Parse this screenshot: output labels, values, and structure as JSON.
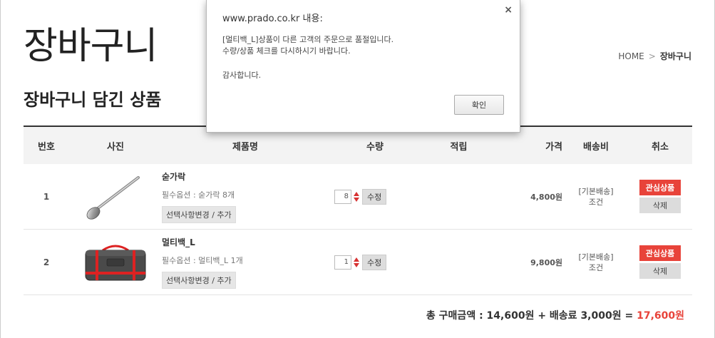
{
  "page": {
    "title": "장바구니",
    "section_title": "장바구니 담긴 상품"
  },
  "breadcrumb": {
    "home": "HOME",
    "separator": ">",
    "current": "장바구니"
  },
  "table": {
    "headers": {
      "no": "번호",
      "photo": "사진",
      "name": "제품명",
      "qty": "수량",
      "point": "적립",
      "price": "가격",
      "ship": "배송비",
      "cancel": "취소"
    },
    "rows": [
      {
        "no": "1",
        "name": "숟가락",
        "option": "필수옵션 : 숟가락 8개",
        "option_button": "선택사항변경 / 추가",
        "qty": "8",
        "qty_button": "수정",
        "price": "4,800원",
        "ship_line1": "[기본배송]",
        "ship_line2": "조건",
        "wish_button": "관심상품",
        "delete_button": "삭제",
        "image_icon": "spoon-icon"
      },
      {
        "no": "2",
        "name": "멀티백_L",
        "option": "필수옵션 : 멀티백_L 1개",
        "option_button": "선택사항변경 / 추가",
        "qty": "1",
        "qty_button": "수정",
        "price": "9,800원",
        "ship_line1": "[기본배송]",
        "ship_line2": "조건",
        "wish_button": "관심상품",
        "delete_button": "삭제",
        "image_icon": "bag-icon"
      }
    ]
  },
  "total": {
    "label": "총 구매금액 : 14,600원 + 배송료 3,000원 = ",
    "grand": "17,600원"
  },
  "dialog": {
    "title": "www.prado.co.kr 내용:",
    "close": "×",
    "line1": "[멀티백_L]상품이 다른 고객의 주문으로 품절입니다.",
    "line2": "수량/상품 체크를 다시하시기 바랍니다.",
    "thanks": "감사합니다.",
    "ok": "확인"
  },
  "colors": {
    "accent": "#e8433a",
    "qty_arrow": "#d73232"
  }
}
